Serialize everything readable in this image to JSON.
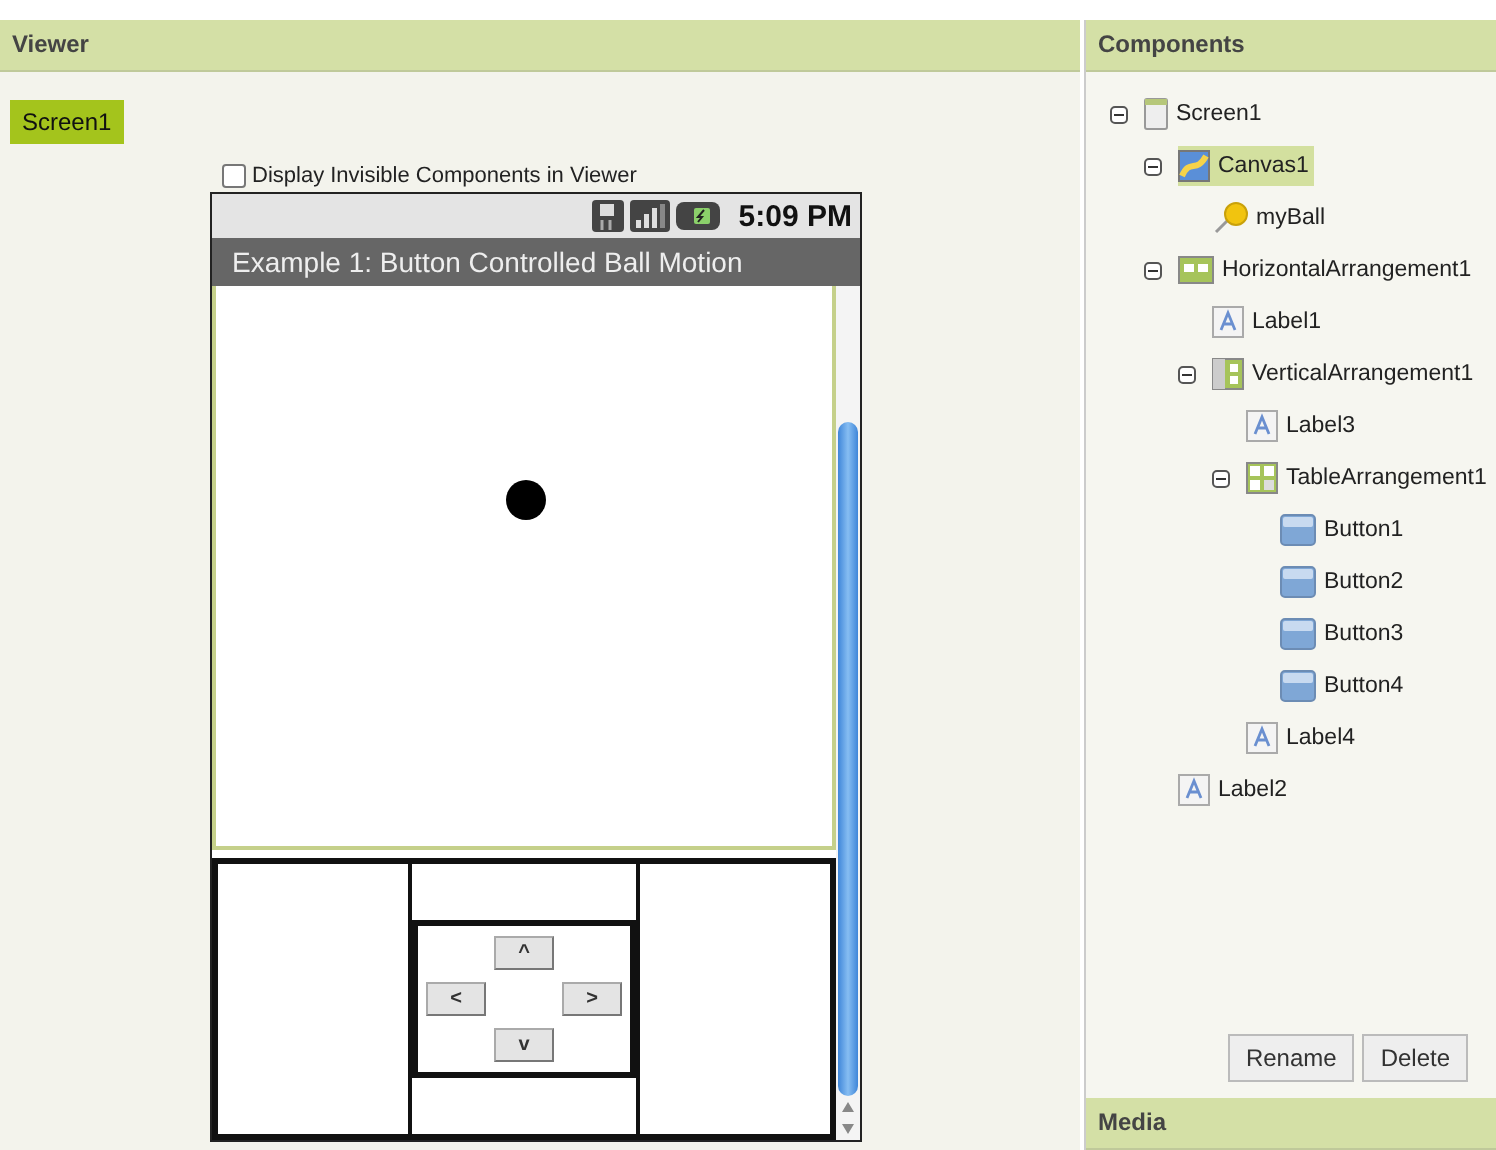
{
  "viewer": {
    "title": "Viewer",
    "screen_tab": {
      "label": "Screen1",
      "selected": true
    },
    "checkbox": {
      "label": "Display Invisible Components in Viewer",
      "checked": false
    },
    "phone": {
      "time": "5:09 PM",
      "title": "Example 1: Button Controlled Ball Motion",
      "buttons": [
        {
          "label": "^",
          "kind": "up"
        },
        {
          "label": "<",
          "kind": "left"
        },
        {
          "label": ">",
          "kind": "right"
        },
        {
          "label": "v",
          "kind": "down"
        }
      ]
    }
  },
  "components": {
    "title": "Components",
    "tree": [
      {
        "name": "Screen1",
        "kind": "screen",
        "selected": false,
        "expanded": true,
        "children": [
          {
            "name": "Canvas1",
            "kind": "canvas",
            "selected": true,
            "expanded": true,
            "children": [
              {
                "name": "myBall",
                "kind": "ball",
                "selected": false
              }
            ]
          },
          {
            "name": "HorizontalArrangement1",
            "kind": "horizontal",
            "selected": false,
            "expanded": true,
            "children": [
              {
                "name": "Label1",
                "kind": "label",
                "selected": false
              },
              {
                "name": "VerticalArrangement1",
                "kind": "vertical",
                "selected": false,
                "expanded": true,
                "children": [
                  {
                    "name": "Label3",
                    "kind": "label",
                    "selected": false
                  },
                  {
                    "name": "TableArrangement1",
                    "kind": "table",
                    "selected": false,
                    "expanded": true,
                    "children": [
                      {
                        "name": "Button1",
                        "kind": "button",
                        "selected": false
                      },
                      {
                        "name": "Button2",
                        "kind": "button",
                        "selected": false
                      },
                      {
                        "name": "Button3",
                        "kind": "button",
                        "selected": false
                      },
                      {
                        "name": "Button4",
                        "kind": "button",
                        "selected": false
                      }
                    ]
                  },
                  {
                    "name": "Label4",
                    "kind": "label",
                    "selected": false
                  }
                ]
              }
            ]
          },
          {
            "name": "Label2",
            "kind": "label",
            "selected": false
          }
        ]
      }
    ],
    "buttons": [
      "Rename",
      "Delete"
    ]
  },
  "media": {
    "title": "Media"
  }
}
